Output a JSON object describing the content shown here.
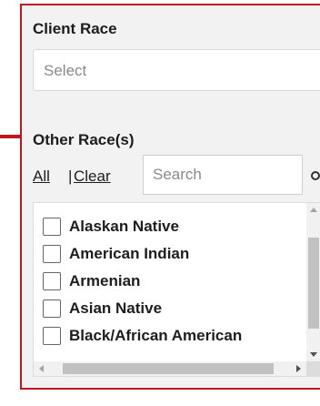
{
  "client_race": {
    "label": "Client Race",
    "placeholder": "Select"
  },
  "other_races": {
    "label": "Other Race(s)",
    "all_label": "All",
    "separator": "|",
    "clear_label": "Clear",
    "search_placeholder": "Search",
    "items": [
      {
        "label": "Alaskan Native",
        "checked": false
      },
      {
        "label": "American Indian",
        "checked": false
      },
      {
        "label": "Armenian",
        "checked": false
      },
      {
        "label": "Asian Native",
        "checked": false
      },
      {
        "label": "Black/African American",
        "checked": false
      }
    ]
  },
  "icons": {
    "dropdown": "chevron-down-icon",
    "search": "search-icon",
    "callout": "arrow-pointer-icon"
  },
  "colors": {
    "highlight_border": "#c0171e",
    "panel_background": "#f2f2f2"
  }
}
